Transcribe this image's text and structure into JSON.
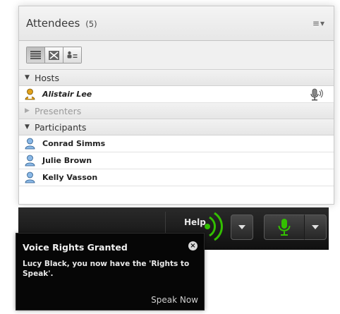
{
  "attendees": {
    "title": "Attendees",
    "count": "(5)",
    "menu_icon": "list-menu-icon",
    "toolbar": [
      {
        "icon": "list-view-icon",
        "active": true
      },
      {
        "icon": "breakout-view-icon",
        "active": false
      },
      {
        "icon": "user-status-icon",
        "active": false
      }
    ],
    "groups": {
      "hosts": {
        "label": "Hosts",
        "expanded": true,
        "members": [
          {
            "name": "Alistair Lee",
            "role_icon": "host-user-icon",
            "speaking_icon": "microphone-speaking-icon"
          }
        ]
      },
      "presenters": {
        "label": "Presenters",
        "expanded": false
      },
      "participants": {
        "label": "Participants",
        "expanded": true,
        "members": [
          {
            "name": "Conrad Simms"
          },
          {
            "name": "Julie Brown"
          },
          {
            "name": "Kelly Vasson"
          }
        ]
      }
    }
  },
  "control_bar": {
    "help_label": "Help",
    "audio_icon": "audio-broadcast-icon",
    "microphone_icon": "microphone-icon",
    "accent": "#33c000"
  },
  "notification": {
    "title": "Voice Rights Granted",
    "message": "Lucy Black, you now have the 'Rights to Speak'.",
    "action": "Speak Now",
    "close_icon": "close-icon"
  }
}
